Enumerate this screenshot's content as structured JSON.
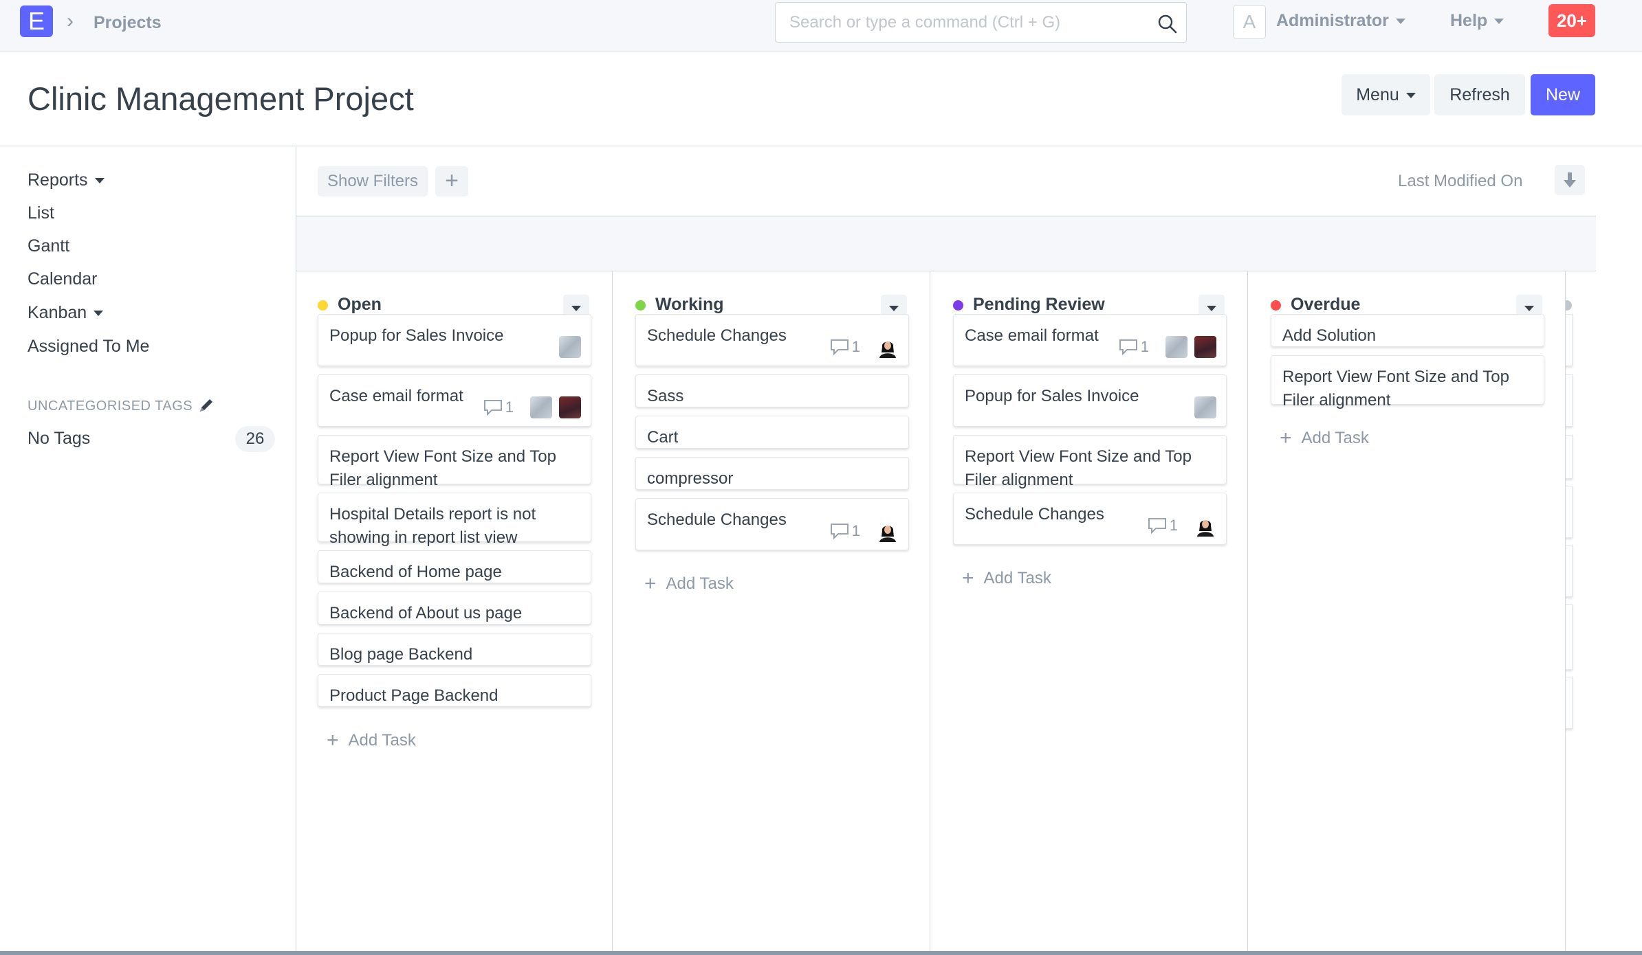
{
  "navbar": {
    "logo_letter": "E",
    "breadcrumb_sep": "›",
    "breadcrumb": "Projects",
    "search_placeholder": "Search or type a command (Ctrl + G)",
    "avatar_letter": "A",
    "user_label": "Administrator",
    "help_label": "Help",
    "notifications": "20+"
  },
  "page": {
    "title": "Clinic Management Project",
    "menu_label": "Menu",
    "refresh_label": "Refresh",
    "new_label": "New",
    "accent": "#5e64ff"
  },
  "sidebar": {
    "items": [
      "Reports",
      "List",
      "Gantt",
      "Calendar",
      "Kanban",
      "Assigned To Me"
    ],
    "tags_section": "UNCATEGORISED TAGS",
    "no_tags_label": "No Tags",
    "no_tags_count": "26"
  },
  "filters": {
    "show_filters": "Show Filters",
    "add": "+",
    "sort_label": "Last Modified On"
  },
  "board": {
    "add_task_label": "Add Task",
    "columns": [
      {
        "title": "Open",
        "color": "#fdd835",
        "cards": [
          {
            "title": "Popup for Sales Invoice",
            "comments": "",
            "avatars": [
              "photo"
            ]
          },
          {
            "title": "Case email format",
            "comments": "1",
            "avatars": [
              "photo",
              "dark"
            ]
          },
          {
            "title": "Report View Font Size and Top Filer alignment",
            "comments": "",
            "avatars": []
          },
          {
            "title": "Hospital Details report is not showing in report list view",
            "comments": "",
            "avatars": []
          },
          {
            "title": "Backend of Home page",
            "comments": "",
            "avatars": []
          },
          {
            "title": "Backend of About us page",
            "comments": "",
            "avatars": []
          },
          {
            "title": "Blog page Backend",
            "comments": "",
            "avatars": []
          },
          {
            "title": "Product Page Backend",
            "comments": "",
            "avatars": []
          }
        ]
      },
      {
        "title": "Working",
        "color": "#7cd645",
        "cards": [
          {
            "title": "Schedule Changes",
            "comments": "1",
            "avatars": [
              "person"
            ]
          },
          {
            "title": "Sass",
            "comments": "",
            "avatars": []
          },
          {
            "title": "Cart",
            "comments": "",
            "avatars": []
          },
          {
            "title": "compressor",
            "comments": "",
            "avatars": []
          },
          {
            "title": "Schedule Changes",
            "comments": "1",
            "avatars": [
              "person"
            ]
          }
        ]
      },
      {
        "title": "Pending Review",
        "color": "#7c3aed",
        "cards": [
          {
            "title": "Case email format",
            "comments": "1",
            "avatars": [
              "photo",
              "dark"
            ]
          },
          {
            "title": "Popup for Sales Invoice",
            "comments": "",
            "avatars": [
              "photo"
            ]
          },
          {
            "title": "Report View Font Size and Top Filer alignment",
            "comments": "",
            "avatars": []
          },
          {
            "title": "Schedule Changes",
            "comments": "1",
            "avatars": [
              "person"
            ]
          }
        ]
      },
      {
        "title": "Overdue",
        "color": "#ff4d4d",
        "cards": [
          {
            "title": "Add Solution",
            "comments": "",
            "avatars": []
          },
          {
            "title": "Report View Font Size and Top Filer alignment",
            "comments": "",
            "avatars": []
          }
        ]
      }
    ]
  }
}
